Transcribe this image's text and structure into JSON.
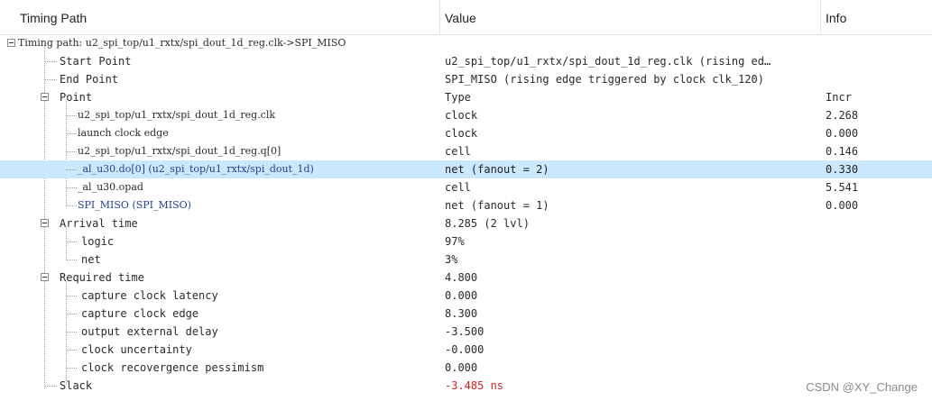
{
  "header": {
    "col1": "Timing Path",
    "col2": "Value",
    "col3": "Info"
  },
  "rows": [
    {
      "label": "Timing path: u2_spi_top/u1_rxtx/spi_dout_1d_reg.clk->SPI_MISO",
      "value": "",
      "info": ""
    },
    {
      "label": "Start Point",
      "value": "u2_spi_top/u1_rxtx/spi_dout_1d_reg.clk (rising ed…",
      "info": ""
    },
    {
      "label": "End Point",
      "value": "SPI_MISO (rising edge triggered by clock clk_120)",
      "info": ""
    },
    {
      "label": "Point",
      "value": "Type",
      "info": "Incr"
    },
    {
      "label": "u2_spi_top/u1_rxtx/spi_dout_1d_reg.clk",
      "value": "clock",
      "info": "2.268"
    },
    {
      "label": "launch clock edge",
      "value": "clock",
      "info": "0.000"
    },
    {
      "label": "u2_spi_top/u1_rxtx/spi_dout_1d_reg.q[0]",
      "value": "cell",
      "info": "0.146"
    },
    {
      "label": "_al_u30.do[0] (u2_spi_top/u1_rxtx/spi_dout_1d)",
      "value": "net (fanout = 2)",
      "info": "0.330"
    },
    {
      "label": "_al_u30.opad",
      "value": "cell",
      "info": "5.541"
    },
    {
      "label": "SPI_MISO (SPI_MISO)",
      "value": "net (fanout = 1)",
      "info": "0.000"
    },
    {
      "label": "Arrival time",
      "value": "8.285 (2 lvl)",
      "info": ""
    },
    {
      "label": "logic",
      "value": "97%",
      "info": ""
    },
    {
      "label": "net",
      "value": "3%",
      "info": ""
    },
    {
      "label": "Required time",
      "value": "4.800",
      "info": ""
    },
    {
      "label": "capture clock latency",
      "value": "0.000",
      "info": ""
    },
    {
      "label": "capture clock edge",
      "value": "8.300",
      "info": ""
    },
    {
      "label": "output external delay",
      "value": "-3.500",
      "info": ""
    },
    {
      "label": "clock uncertainty",
      "value": "-0.000",
      "info": ""
    },
    {
      "label": "clock recovergence pessimism",
      "value": "0.000",
      "info": ""
    },
    {
      "label": "Slack",
      "value": "-3.485 ns",
      "info": ""
    }
  ],
  "watermark": "CSDN @XY_Change",
  "colors": {
    "selection": "#cce8ff",
    "link_blue": "#1f3fa0",
    "slack_red": "#e02020"
  }
}
